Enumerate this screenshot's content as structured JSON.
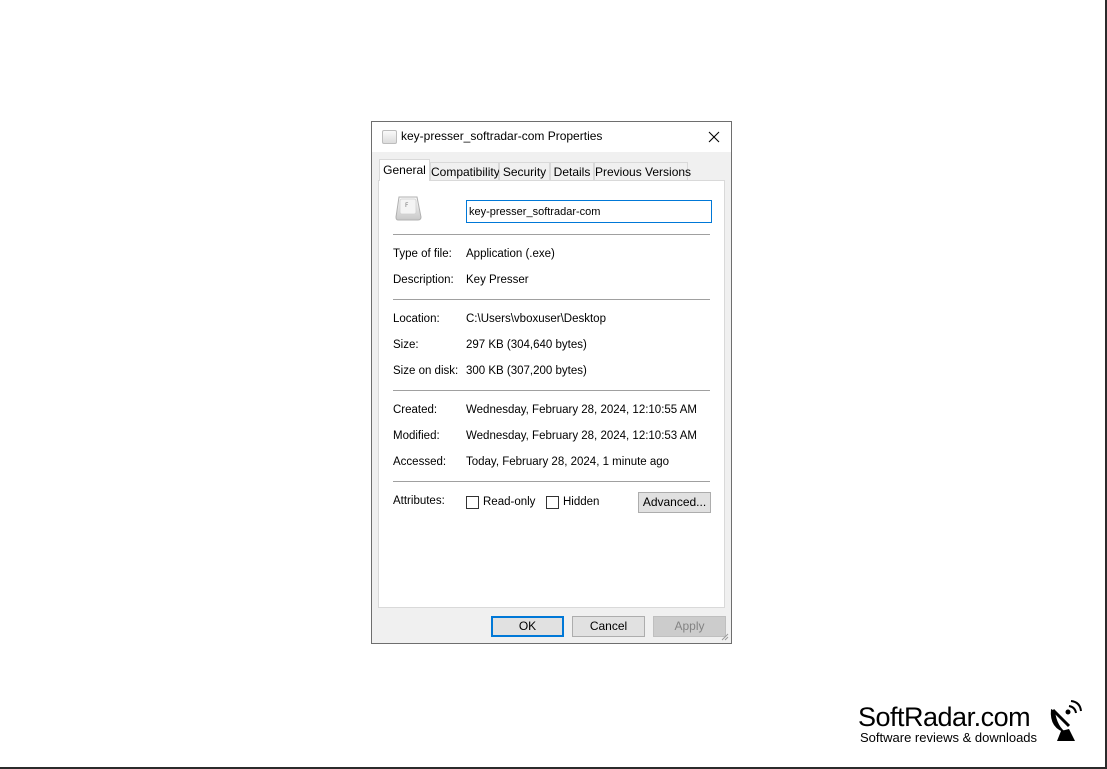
{
  "window": {
    "title": "key-presser_softradar-com Properties"
  },
  "tabs": [
    {
      "label": "General",
      "active": true
    },
    {
      "label": "Compatibility",
      "active": false
    },
    {
      "label": "Security",
      "active": false
    },
    {
      "label": "Details",
      "active": false
    },
    {
      "label": "Previous Versions",
      "active": false
    }
  ],
  "general": {
    "file_name": "key-presser_softradar-com",
    "type_label": "Type of file:",
    "type_value": "Application (.exe)",
    "description_label": "Description:",
    "description_value": "Key Presser",
    "location_label": "Location:",
    "location_value": "C:\\Users\\vboxuser\\Desktop",
    "size_label": "Size:",
    "size_value": "297 KB (304,640 bytes)",
    "size_on_disk_label": "Size on disk:",
    "size_on_disk_value": "300 KB (307,200 bytes)",
    "created_label": "Created:",
    "created_value": "Wednesday, February 28, 2024, 12:10:55 AM",
    "modified_label": "Modified:",
    "modified_value": "Wednesday, February 28, 2024, 12:10:53 AM",
    "accessed_label": "Accessed:",
    "accessed_value": "Today, February 28, 2024, 1 minute ago",
    "attributes_label": "Attributes:",
    "readonly_label": "Read-only",
    "readonly_checked": false,
    "hidden_label": "Hidden",
    "hidden_checked": false,
    "advanced_label": "Advanced..."
  },
  "buttons": {
    "ok": "OK",
    "cancel": "Cancel",
    "apply": "Apply"
  },
  "watermark": {
    "name": "SoftRadar.com",
    "tagline": "Software reviews & downloads"
  },
  "colors": {
    "accent": "#0078d7",
    "dialog_bg": "#f0f0f0",
    "panel_bg": "#ffffff"
  }
}
